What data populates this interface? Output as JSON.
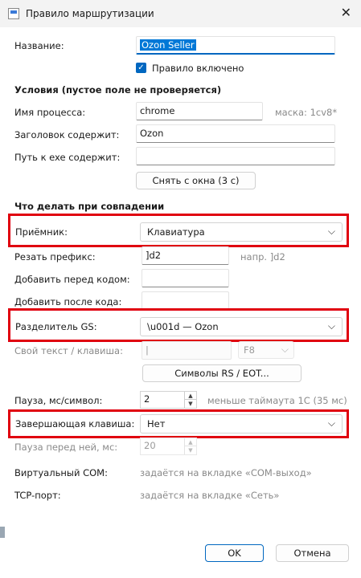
{
  "window": {
    "title": "Правило маршрутизации",
    "close": "✕"
  },
  "name_label": "Название:",
  "name_value": "Ozon Seller",
  "enabled_label": "Правило включено",
  "conditions_header": "Условия (пустое поле не проверяется)",
  "process_label": "Имя процесса:",
  "process_value": "chrome",
  "process_mask": "маска: 1cv8*",
  "title_label": "Заголовок содержит:",
  "title_value": "Ozon",
  "exe_label": "Путь к exe содержит:",
  "exe_value": "",
  "capture_button": "Снять с окна (3 с)",
  "actions_header": "Что делать при совпадении",
  "receiver_label": "Приёмник:",
  "receiver_value": "Клавиатура",
  "prefix_label": "Резать префикс:",
  "prefix_value": "]d2",
  "prefix_hint": "напр. ]d2",
  "before_label": "Добавить перед кодом:",
  "before_value": "",
  "after_label": "Добавить после кода:",
  "after_value": "",
  "gs_label": "Разделитель GS:",
  "gs_value": "\\u001d — Ozon",
  "custom_label": "Свой текст / клавиша:",
  "custom_value": "|",
  "custom_key": "F8",
  "rs_button": "Символы RS / EOT...",
  "pause_label": "Пауза, мс/символ:",
  "pause_value": "2",
  "pause_hint": "меньше таймаута 1С (35 мс)",
  "final_key_label": "Завершающая клавиша:",
  "final_key_value": "Нет",
  "pause_before_label": "Пауза перед ней, мс:",
  "pause_before_value": "20",
  "com_label": "Виртуальный COM:",
  "com_value": "задаётся на вкладке «COM-выход»",
  "tcp_label": "TCP-порт:",
  "tcp_value": "задаётся на вкладке «Сеть»",
  "ok_button": "OK",
  "cancel_button": "Отмена",
  "icons": {
    "check": "✓",
    "chevron": "⌵",
    "up": "▲",
    "down": "▼"
  },
  "colors": {
    "accent": "#0067c0",
    "highlight": "#e0000f"
  }
}
